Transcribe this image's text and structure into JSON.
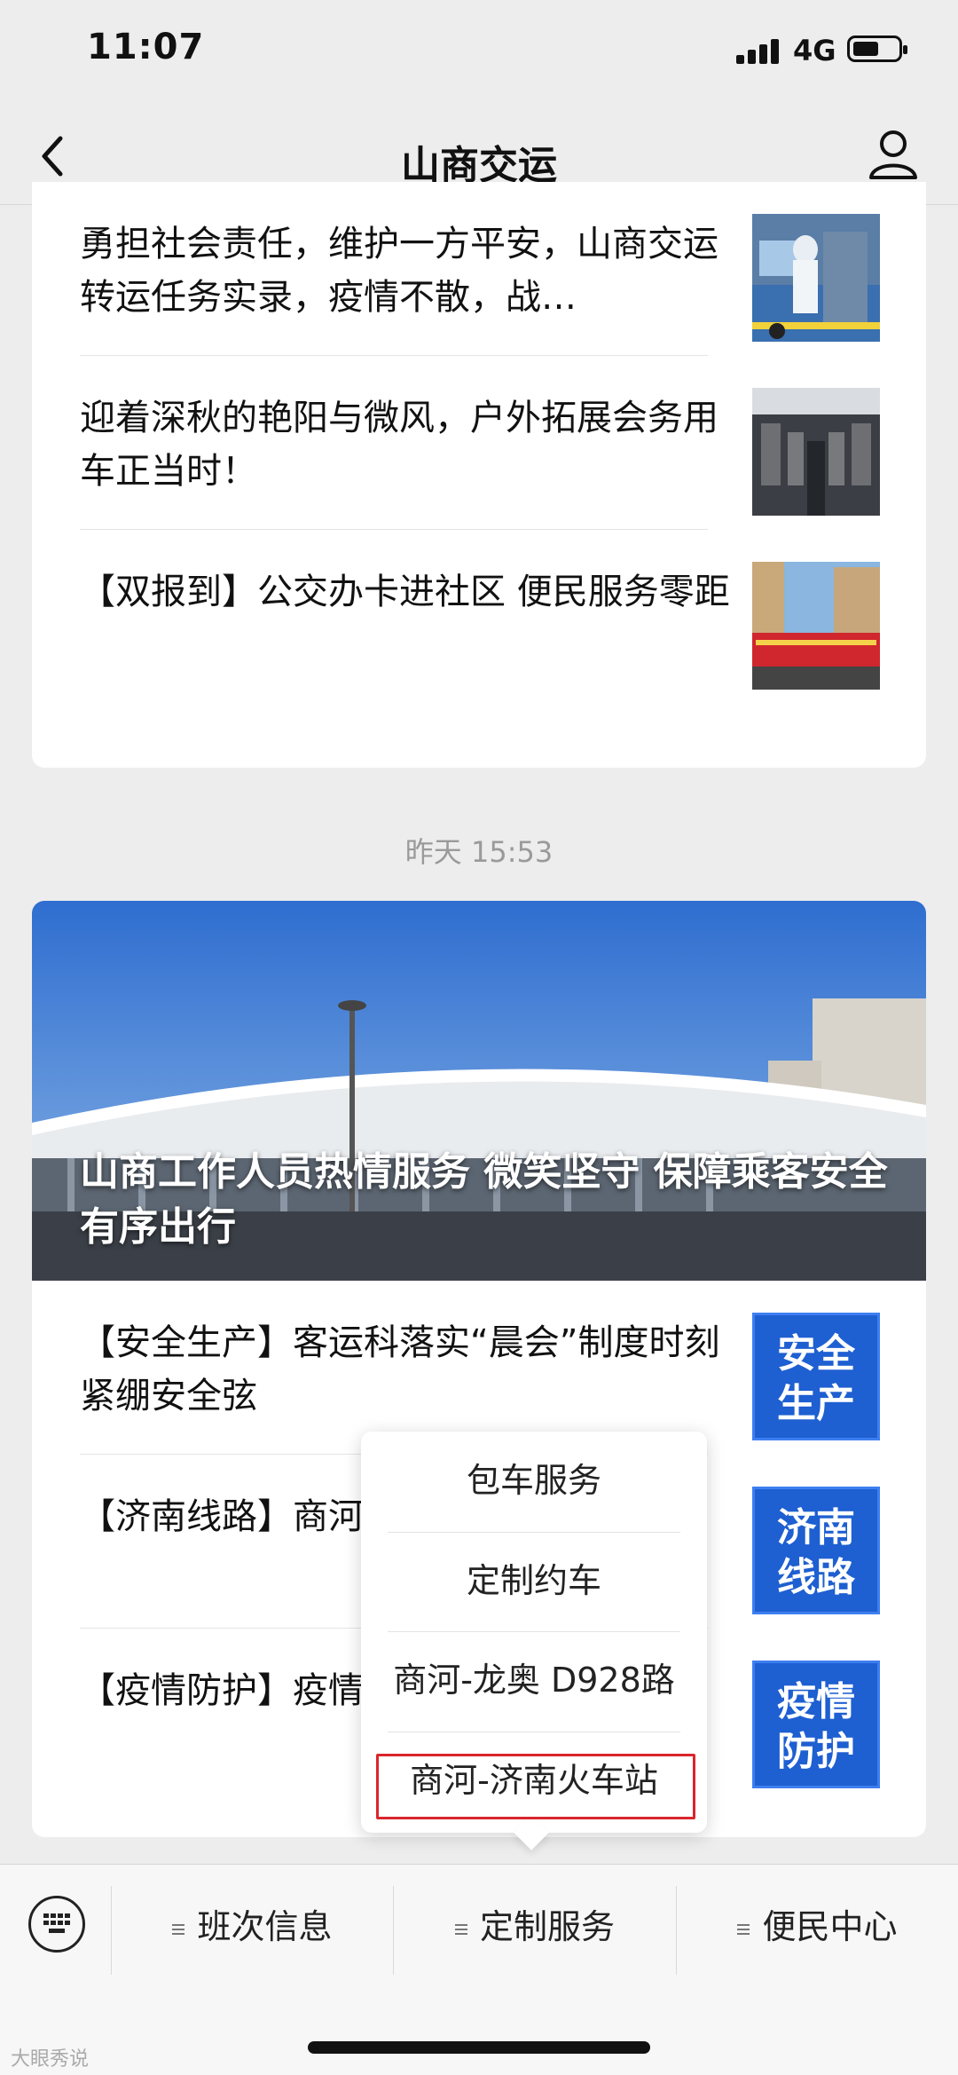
{
  "status": {
    "time": "11:07",
    "network": "4G"
  },
  "nav": {
    "title": "山商交运"
  },
  "feed1": {
    "items": [
      {
        "title": "勇担社会责任，维护一方平安，山商交运转运任务实录，疫情不散，战…"
      },
      {
        "title": "迎着深秋的艳阳与微风，户外拓展会务用车正当时！"
      },
      {
        "title": "【双报到】公交办卡进社区 便民服务零距"
      }
    ]
  },
  "timestamp": "昨天 15:53",
  "feed2": {
    "hero_title": "山商工作人员热情服务 微笑坚守 保障乘客安全有序出行",
    "items": [
      {
        "title": "【安全生产】客运科落实“晨会”制度时刻紧绷安全弦",
        "tag_line1": "安全",
        "tag_line2": "生产"
      },
      {
        "title": "【济南线路】商河方式Get起来！",
        "tag_line1": "济南",
        "tag_line2": "线路"
      },
      {
        "title": "【疫情防护】疫情戴口罩！不聚集！",
        "tag_line1": "疫情",
        "tag_line2": "防护"
      }
    ]
  },
  "popup": {
    "items": [
      "包车服务",
      "定制约车",
      "商河-龙奥 D928路",
      "商河-济南火车站"
    ]
  },
  "bottom_menu": {
    "tabs": [
      "班次信息",
      "定制服务",
      "便民中心"
    ]
  },
  "watermark": "大眼秀说",
  "colors": {
    "accent_blue": "#1e5fd1",
    "highlight_red": "#d9262c"
  }
}
